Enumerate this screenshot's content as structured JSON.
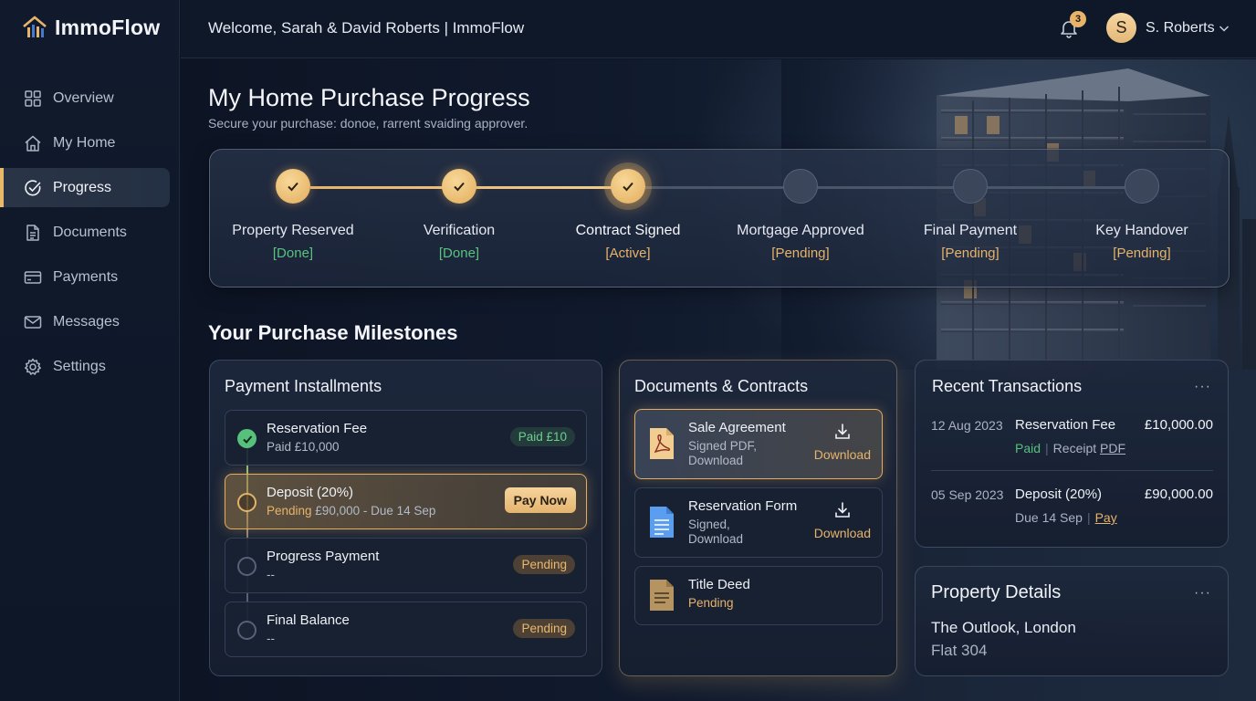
{
  "app": {
    "name": "ImmoFlow"
  },
  "sidebar": {
    "items": [
      {
        "label": "Overview",
        "icon": "grid-icon",
        "active": false
      },
      {
        "label": "My Home",
        "icon": "home-icon",
        "active": false
      },
      {
        "label": "Progress",
        "icon": "progress-check-icon",
        "active": true
      },
      {
        "label": "Documents",
        "icon": "document-icon",
        "active": false
      },
      {
        "label": "Payments",
        "icon": "credit-card-icon",
        "active": false
      },
      {
        "label": "Messages",
        "icon": "mail-icon",
        "active": false
      },
      {
        "label": "Settings",
        "icon": "gear-icon",
        "active": false
      }
    ]
  },
  "header": {
    "welcome": "Welcome, Sarah & David Roberts | ImmoFlow",
    "notifications_count": "3",
    "avatar_initial": "S",
    "user_name": "S. Roberts"
  },
  "page": {
    "title": "My Home Purchase Progress",
    "subtitle": "Secure your purchase: donoe, rarrent svaiding approver."
  },
  "stepper": {
    "steps": [
      {
        "label": "Property Reserved",
        "status": "[Done]",
        "state": "done"
      },
      {
        "label": "Verification",
        "status": "[Done]",
        "state": "done"
      },
      {
        "label": "Contract Signed",
        "status": "[Active]",
        "state": "active"
      },
      {
        "label": "Mortgage Approved",
        "status": "[Pending]",
        "state": "pending"
      },
      {
        "label": "Final Payment",
        "status": "[Pending]",
        "state": "pending"
      },
      {
        "label": "Key Handover",
        "status": "[Pending]",
        "state": "pending"
      }
    ]
  },
  "milestones": {
    "title": "Your Purchase Milestones",
    "payments": {
      "title": "Payment Installments",
      "items": [
        {
          "name": "Reservation Fee",
          "detail_prefix": "",
          "detail": "Paid £10,000",
          "badge": "Paid £10",
          "state": "done"
        },
        {
          "name": "Deposit (20%)",
          "detail_prefix": "Pending",
          "detail": " £90,000 - Due 14 Sep",
          "button": "Pay Now",
          "state": "active"
        },
        {
          "name": "Progress Payment",
          "detail_prefix": "",
          "detail": "--",
          "badge": "Pending",
          "state": "pending"
        },
        {
          "name": "Final Balance",
          "detail_prefix": "",
          "detail": "--",
          "badge": "Pending",
          "state": "pending"
        }
      ]
    },
    "documents": {
      "title": "Documents & Contracts",
      "items": [
        {
          "name": "Sale Agreement",
          "line1": "Signed PDF,",
          "line2": "Download",
          "action": "Download"
        },
        {
          "name": "Reservation Form",
          "line1": "Signed,",
          "line2": "Download",
          "action": "Download"
        },
        {
          "name": "Title Deed",
          "line1": "Pending",
          "line2": ""
        }
      ]
    },
    "transactions": {
      "title": "Recent Transactions",
      "more": "···",
      "items": [
        {
          "date": "12 Aug 2023",
          "name": "Reservation Fee",
          "amount": "£10,000.00",
          "status": "Paid",
          "meta": "Receipt",
          "link": "PDF"
        },
        {
          "date": "05 Sep 2023",
          "name": "Deposit (20%)",
          "amount": "£90,000.00",
          "meta": "Due 14 Sep",
          "link": "Pay"
        }
      ]
    },
    "property": {
      "title": "Property Details",
      "more": "···",
      "name": "The Outlook, London",
      "unit": "Flat 304"
    }
  },
  "colors": {
    "accent": "#e6b36b",
    "success": "#57c07d",
    "background": "#0d1424",
    "card": "#1e283c"
  }
}
